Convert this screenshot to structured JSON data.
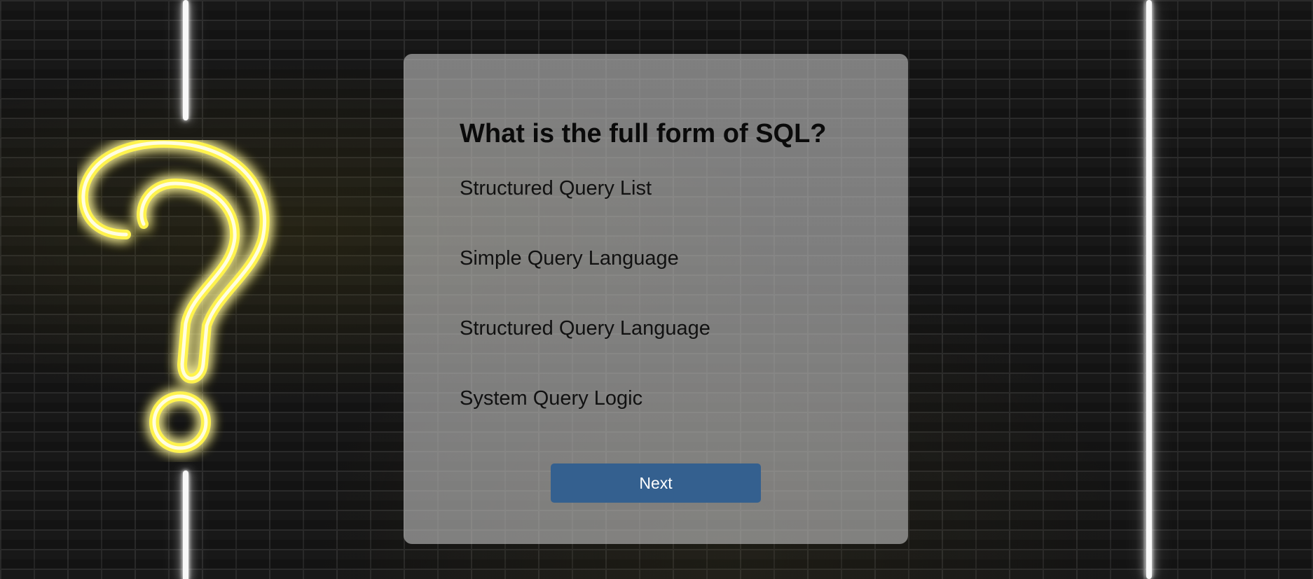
{
  "quiz": {
    "question": "What is the full form of SQL?",
    "options": [
      "Structured Query List",
      "Simple Query Language",
      "Structured Query Language",
      "System Query Logic"
    ],
    "next_label": "Next"
  },
  "colors": {
    "neon_yellow": "#fff34d",
    "neon_white": "#ffffff",
    "button": "#34608f"
  }
}
